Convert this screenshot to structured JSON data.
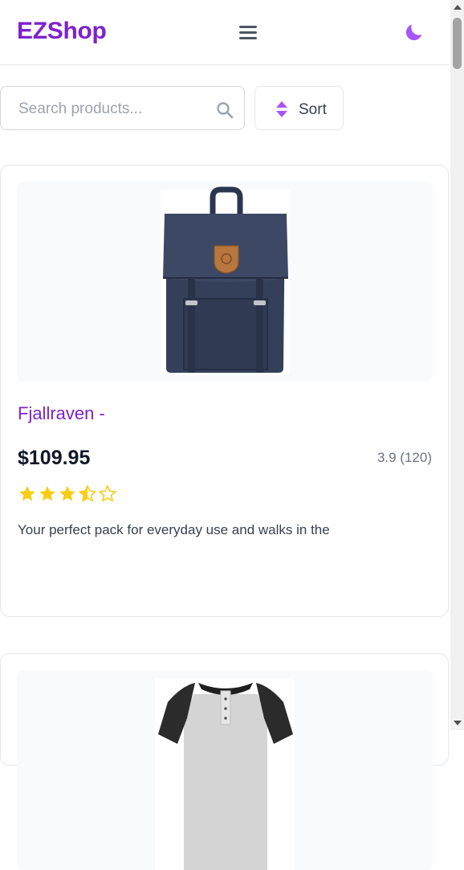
{
  "header": {
    "brand": "EZShop",
    "menu_icon": "hamburger-menu-icon",
    "theme_icon": "moon-icon",
    "accent_color": "#7e22ce"
  },
  "toolbar": {
    "search_placeholder": "Search products...",
    "search_icon": "search-icon",
    "sort_label": "Sort",
    "sort_icon": "sort-arrows-icon"
  },
  "products": [
    {
      "title": "Fjallraven -",
      "price": "$109.95",
      "rating_text": "3.9 (120)",
      "rating_value": 3.9,
      "description": "Your perfect pack for everyday use and walks in the",
      "image": "backpack-image"
    },
    {
      "image": "raglan-shirt-image"
    }
  ],
  "star_color": "#facc15"
}
